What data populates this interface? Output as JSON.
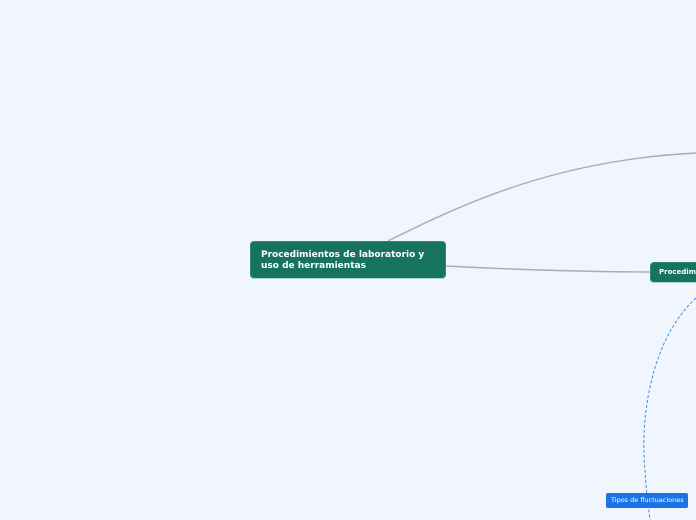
{
  "mindmap": {
    "root": {
      "label": "Procedimientos de laboratorio y uso de herramientas"
    },
    "branch": {
      "label": "Procedimientos"
    },
    "leaf": {
      "label": "Tipos de fluctuaciones"
    },
    "colors": {
      "background": "#f1f5fe",
      "main_node": "#15735e",
      "leaf_node": "#1a73e8",
      "connector": "#a8adb7",
      "dashed_connector": "#3a8fe0"
    }
  }
}
